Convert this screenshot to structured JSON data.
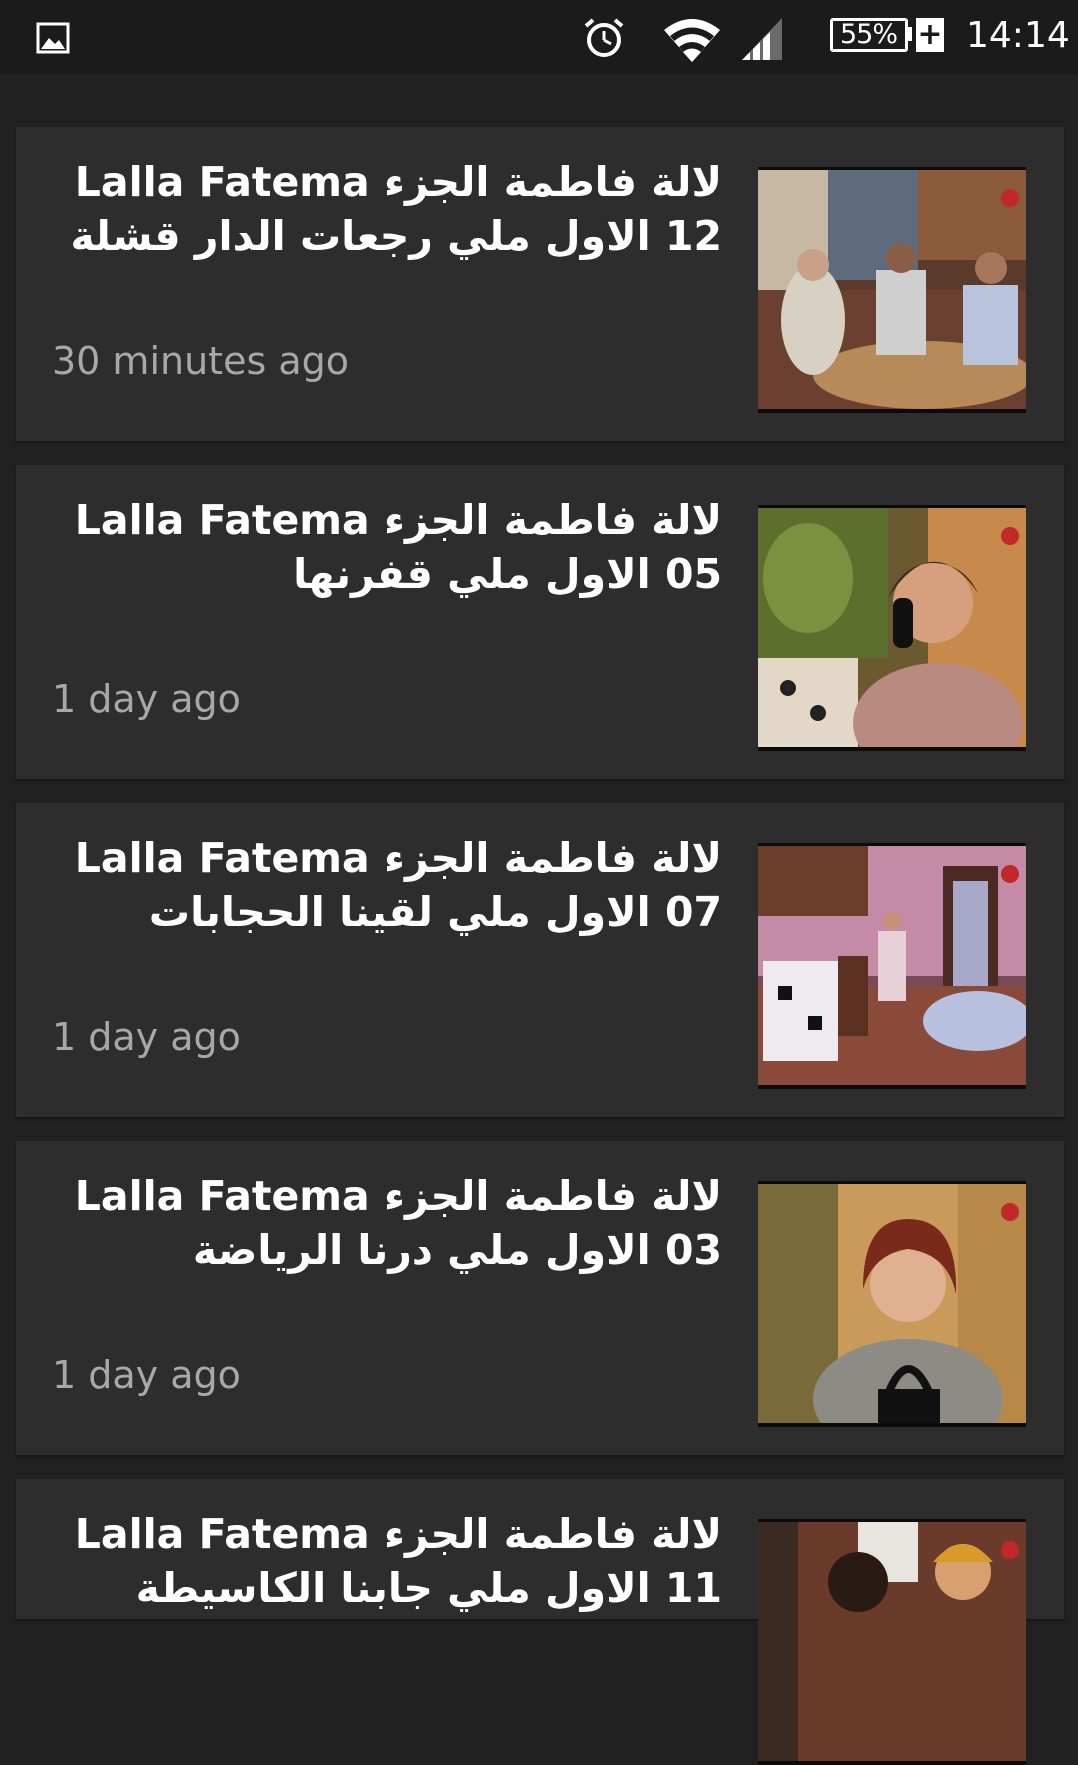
{
  "status_bar": {
    "notification_icon": "image-icon",
    "alarm_icon": "alarm-icon",
    "wifi_icon": "wifi-icon",
    "signal_icon": "signal-icon",
    "battery_level": "55%",
    "battery_charging": "+",
    "time": "14:14"
  },
  "videos": [
    {
      "title": "لالة فاطمة الجزء Lalla Fatema 12 الاول ملي رجعات الدار قشلة",
      "time": "30 minutes ago",
      "thumbnail_icon": "video-thumbnail"
    },
    {
      "title": "لالة فاطمة الجزء Lalla Fatema 05 الاول ملي قفرنها",
      "time": "1 day ago",
      "thumbnail_icon": "video-thumbnail"
    },
    {
      "title": "لالة فاطمة الجزء Lalla Fatema 07 الاول ملي لقينا الحجابات",
      "time": "1 day ago",
      "thumbnail_icon": "video-thumbnail"
    },
    {
      "title": "لالة فاطمة الجزء Lalla Fatema 03 الاول ملي درنا الرياضة",
      "time": "1 day ago",
      "thumbnail_icon": "video-thumbnail"
    },
    {
      "title": "لالة فاطمة الجزء Lalla Fatema 11 الاول ملي جابنا الكاسيطة",
      "time": "",
      "thumbnail_icon": "video-thumbnail"
    }
  ],
  "colors": {
    "background": "#212121",
    "card": "#2d2d2d",
    "status_bar": "#1b1b1b",
    "title_text": "#ffffff",
    "time_text": "#a8a8a8"
  }
}
